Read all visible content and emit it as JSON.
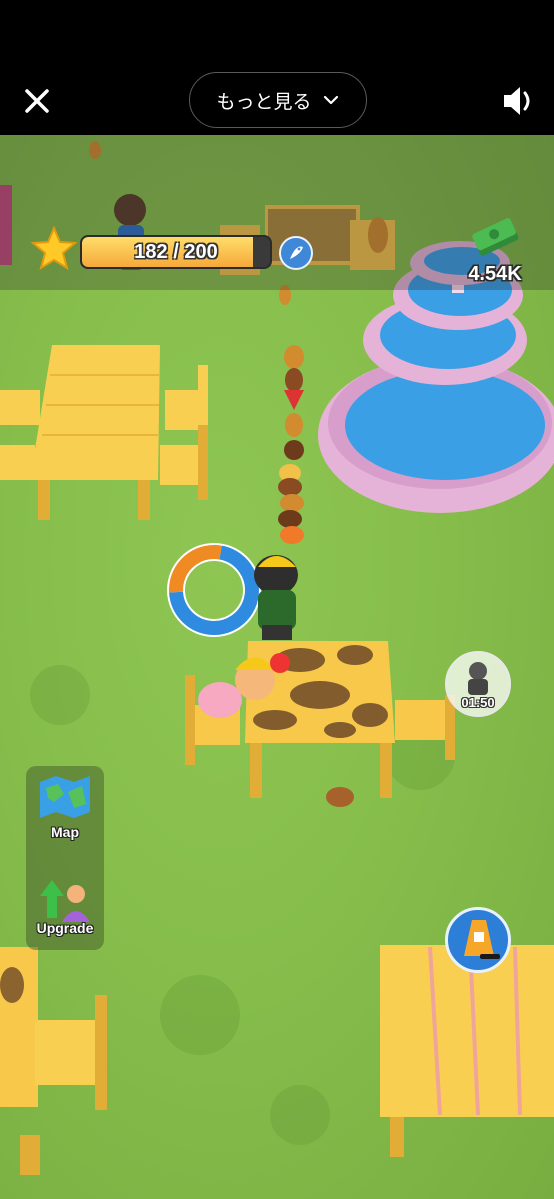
{
  "header": {
    "close_icon": "close-icon",
    "more_label": "もっと見る",
    "more_chevron_icon": "chevron-down-icon",
    "sound_icon": "speaker-icon"
  },
  "hud": {
    "xp_text": "182 / 200",
    "xp_current": 182,
    "xp_max": 200,
    "level_icon": "star-icon",
    "fish_icon": "fish-icon",
    "cash_icon": "cash-stack-icon",
    "cash_text": "4.54K"
  },
  "side_menu": {
    "map_label": "Map",
    "upgrade_label": "Upgrade"
  },
  "timer": {
    "icon": "worker-icon",
    "text": "01:50"
  },
  "clean_button": {
    "icon": "wet-floor-sign-icon"
  },
  "colors": {
    "grass": "#86bd4b",
    "table": "#f7c84a",
    "fountain": "#e6b3d8",
    "water": "#3b9fe6",
    "xp_fill": "#f6a93a"
  }
}
